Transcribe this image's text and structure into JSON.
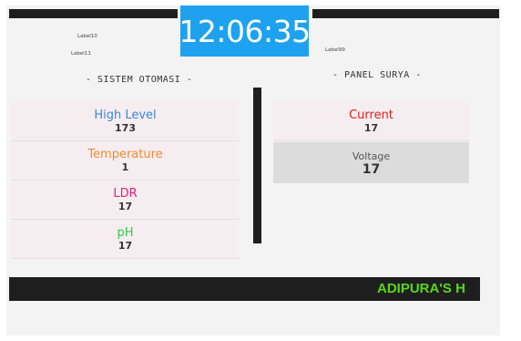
{
  "clock": {
    "time": "12:06:35"
  },
  "labels": {
    "label10": "Label10",
    "label11": "Label11",
    "label99": "Label99"
  },
  "sistem": {
    "title": "- SISTEM OTOMASI -",
    "cards": [
      {
        "label": "High Level",
        "value": "173",
        "color": "#3a86d8"
      },
      {
        "label": "Temperature",
        "value": "1",
        "color": "#f08a2a"
      },
      {
        "label": "LDR",
        "value": "17",
        "color": "#e0227a"
      },
      {
        "label": "pH",
        "value": "17",
        "color": "#2ecc40"
      }
    ]
  },
  "panel_surya": {
    "title": "- PANEL SURYA -",
    "cards": [
      {
        "label": "Current",
        "value": "17",
        "color": "#e0201e"
      },
      {
        "label": "Voltage",
        "value": "17",
        "color": "#555555"
      }
    ]
  },
  "ticker": {
    "text": "ADIPURA'S H",
    "color": "#57d71a"
  }
}
